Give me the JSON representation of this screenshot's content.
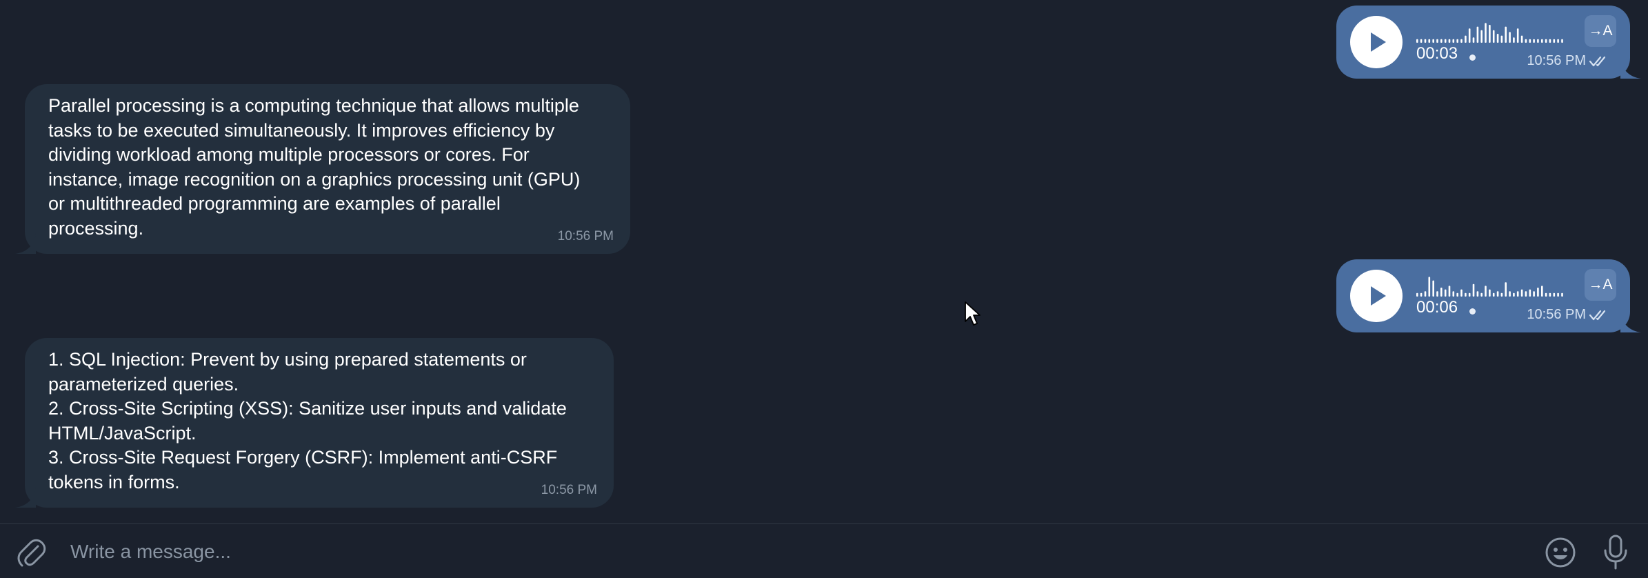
{
  "colors": {
    "background": "#1b212d",
    "incoming_bubble": "#232f3d",
    "outgoing_bubble": "#4a6ea0",
    "text": "#ffffff",
    "muted": "#8c98a6"
  },
  "messages": {
    "voice_1": {
      "duration": "00:03",
      "time": "10:56 PM",
      "transcribe_label": "→A",
      "play_icon": "play-icon",
      "status_icon": "double-check-icon"
    },
    "text_1": {
      "text": "Parallel processing is a computing technique that allows multiple\ntasks to be executed simultaneously. It improves efficiency by\ndividing workload among multiple processors or cores. For\ninstance, image recognition on a graphics processing unit (GPU)\nor multithreaded programming are examples of parallel\nprocessing.",
      "time": "10:56 PM"
    },
    "voice_2": {
      "duration": "00:06",
      "time": "10:56 PM",
      "transcribe_label": "→A",
      "play_icon": "play-icon",
      "status_icon": "double-check-icon"
    },
    "text_2": {
      "text": "1. SQL Injection: Prevent by using prepared statements or\nparameterized queries.\n2. Cross-Site Scripting (XSS): Sanitize user inputs and validate\nHTML/JavaScript.\n3. Cross-Site Request Forgery (CSRF): Implement anti-CSRF\ntokens in forms.",
      "time": "10:56 PM"
    }
  },
  "composer": {
    "placeholder": "Write a message...",
    "attach_icon": "paperclip-icon",
    "emoji_icon": "smiley-icon",
    "mic_icon": "microphone-icon"
  }
}
